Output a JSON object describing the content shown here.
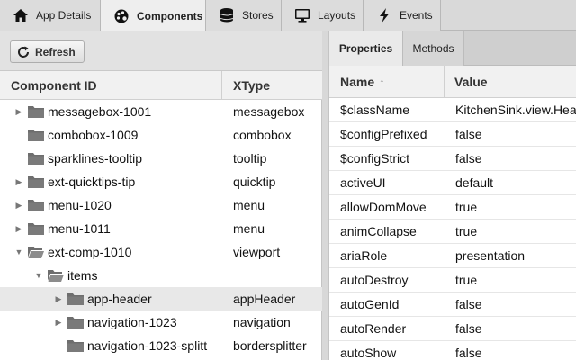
{
  "top_tabs": [
    {
      "label": "App Details",
      "icon": "home-icon"
    },
    {
      "label": "Components",
      "icon": "palette-icon"
    },
    {
      "label": "Stores",
      "icon": "database-icon"
    },
    {
      "label": "Layouts",
      "icon": "monitor-icon"
    },
    {
      "label": "Events",
      "icon": "lightning-icon"
    }
  ],
  "active_top_tab": "Components",
  "toolbar": {
    "refresh_label": "Refresh"
  },
  "component_grid": {
    "headers": {
      "id": "Component ID",
      "xtype": "XType"
    },
    "rows": [
      {
        "id": "messagebox-1001",
        "xtype": "messagebox",
        "expandable": true,
        "expanded": false,
        "depth": 0
      },
      {
        "id": "combobox-1009",
        "xtype": "combobox",
        "expandable": false,
        "expanded": false,
        "depth": 0
      },
      {
        "id": "sparklines-tooltip",
        "xtype": "tooltip",
        "expandable": false,
        "expanded": false,
        "depth": 0
      },
      {
        "id": "ext-quicktips-tip",
        "xtype": "quicktip",
        "expandable": true,
        "expanded": false,
        "depth": 0
      },
      {
        "id": "menu-1020",
        "xtype": "menu",
        "expandable": true,
        "expanded": false,
        "depth": 0
      },
      {
        "id": "menu-1011",
        "xtype": "menu",
        "expandable": true,
        "expanded": false,
        "depth": 0
      },
      {
        "id": "ext-comp-1010",
        "xtype": "viewport",
        "expandable": true,
        "expanded": true,
        "depth": 0
      },
      {
        "id": "items",
        "xtype": "",
        "expandable": true,
        "expanded": true,
        "depth": 1
      },
      {
        "id": "app-header",
        "xtype": "appHeader",
        "expandable": true,
        "expanded": false,
        "depth": 2,
        "selected": true
      },
      {
        "id": "navigation-1023",
        "xtype": "navigation",
        "expandable": true,
        "expanded": false,
        "depth": 2
      },
      {
        "id": "navigation-1023-splitt",
        "xtype": "bordersplitter",
        "expandable": false,
        "expanded": false,
        "depth": 2
      }
    ]
  },
  "right_tabs": [
    {
      "label": "Properties",
      "active": true
    },
    {
      "label": "Methods",
      "active": false
    }
  ],
  "properties": {
    "headers": {
      "name": "Name",
      "value": "Value",
      "sort_indicator": "↑"
    },
    "rows": [
      {
        "name": "$className",
        "value": "KitchenSink.view.Hea"
      },
      {
        "name": "$configPrefixed",
        "value": "false"
      },
      {
        "name": "$configStrict",
        "value": "false"
      },
      {
        "name": "activeUI",
        "value": "default"
      },
      {
        "name": "allowDomMove",
        "value": "true"
      },
      {
        "name": "animCollapse",
        "value": "true"
      },
      {
        "name": "ariaRole",
        "value": "presentation"
      },
      {
        "name": "autoDestroy",
        "value": "true"
      },
      {
        "name": "autoGenId",
        "value": "false"
      },
      {
        "name": "autoRender",
        "value": "false"
      },
      {
        "name": "autoShow",
        "value": "false"
      }
    ]
  },
  "colors": {
    "folder": "#6e6e6e",
    "selected_row": "#e8e8e8"
  }
}
